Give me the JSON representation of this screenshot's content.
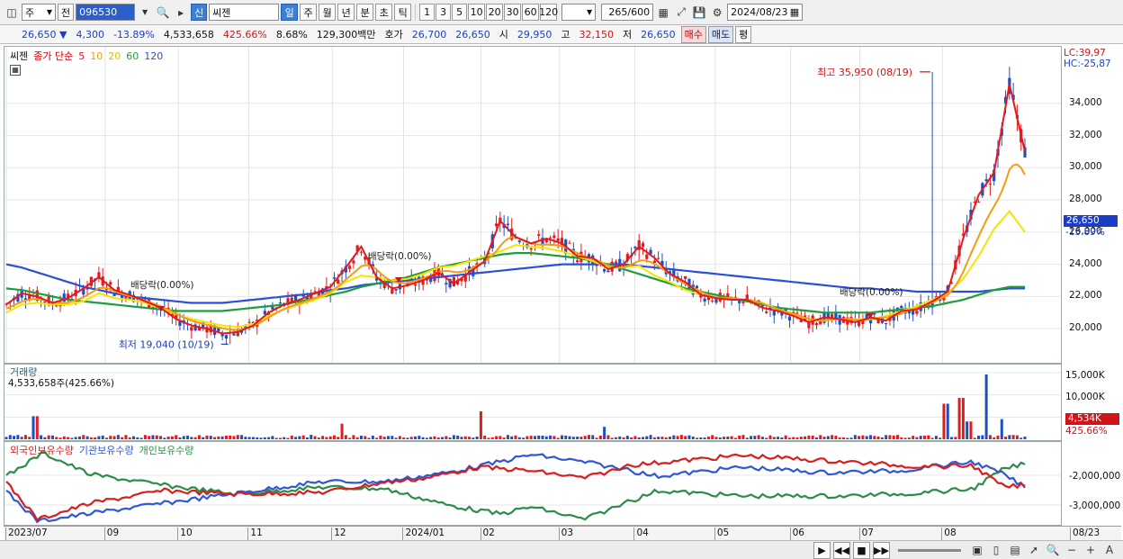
{
  "toolbar": {
    "period_week": "주",
    "prev_label": "전",
    "code": "096530",
    "badge_new": "신",
    "stock_name": "씨젠",
    "tf_day": "일",
    "tf_week": "주",
    "tf_month": "월",
    "tf_year": "년",
    "tf_min": "분",
    "tf_sec": "초",
    "tf_tick": "틱",
    "intervals": [
      "1",
      "3",
      "5",
      "10",
      "20",
      "30",
      "60",
      "120"
    ],
    "count": "265",
    "count_total": "/600",
    "date": "2024/08/23"
  },
  "quote": {
    "price": "26,650",
    "change": "4,300",
    "change_pct": "-13.89%",
    "volume": "4,533,658",
    "vol_ratio": "425.66%",
    "turnover": "8.68%",
    "amount": "129,300백만",
    "bid_label": "호가",
    "bid1": "26,700",
    "bid2": "26,650",
    "open_label": "시",
    "open": "29,950",
    "high_label": "고",
    "high": "32,150",
    "low_label": "저",
    "low": "26,650",
    "buy": "매수",
    "sell": "매도",
    "eval": "평"
  },
  "icons": {
    "down_arrow": "down-triangle-icon"
  },
  "chart_data": [
    {
      "type": "line",
      "name": "price",
      "legend": {
        "title": "씨젠",
        "ma_label": "종가 단순",
        "periods": [
          "5",
          "10",
          "20",
          "60",
          "120"
        ]
      },
      "colors": {
        "ma5": "#e41a1c",
        "ma10": "#f39c12",
        "ma20": "#f5e400",
        "ma60": "#1e9e3a",
        "ma120": "#2a50d8",
        "up": "#e41a1c",
        "down": "#1f4fbf"
      },
      "x": [
        "2023/07",
        "09",
        "10",
        "11",
        "12",
        "2024/01",
        "02",
        "03",
        "04",
        "05",
        "06",
        "07",
        "08",
        "08/23"
      ],
      "ylim": [
        18500,
        36500
      ],
      "yticks": [
        "20,000",
        "22,000",
        "24,000",
        "26,000",
        "28,000",
        "30,000",
        "32,000",
        "34,000"
      ],
      "ma5_key": [
        21500,
        22200,
        22000,
        21600,
        21900,
        22500,
        23200,
        22400,
        22100,
        21700,
        21300,
        20600,
        20200,
        20000,
        19700,
        19800,
        20200,
        21000,
        21500,
        21800,
        22200,
        22600,
        23800,
        25100,
        23200,
        22500,
        22700,
        23000,
        23500,
        22800,
        23500,
        24200,
        26700,
        25700,
        25300,
        25600,
        25300,
        24500,
        24400,
        23700,
        24000,
        25100,
        24400,
        23400,
        22900,
        22100,
        21900,
        21800,
        21800,
        21300,
        21100,
        20800,
        20400,
        20700,
        20600,
        20400,
        20700,
        20500,
        21100,
        21200,
        21700,
        22300,
        25600,
        28300,
        29700,
        35200,
        31000
      ],
      "ma20_key": [
        21000,
        21500,
        21600,
        21500,
        21500,
        21700,
        22200,
        21900,
        21800,
        21600,
        21300,
        20900,
        20600,
        20400,
        20200,
        20100,
        20300,
        20800,
        21200,
        21500,
        21800,
        22200,
        22900,
        23300,
        23200,
        23000,
        23100,
        23400,
        23800,
        23900,
        24200,
        24500,
        24800,
        25200,
        25100,
        25000,
        24800,
        24500,
        24200,
        23800,
        23800,
        23900,
        23300,
        22900,
        22400,
        22100,
        21900,
        21900,
        21800,
        21600,
        21200,
        20900,
        20600,
        20500,
        20600,
        20600,
        20600,
        20800,
        21100,
        21400,
        21800,
        22200,
        23100,
        24500,
        26200,
        27300,
        26000
      ],
      "ma60_key": [
        22500,
        22400,
        22200,
        22000,
        21800,
        21700,
        21600,
        21500,
        21400,
        21300,
        21200,
        21100,
        21100,
        21100,
        21100,
        21200,
        21300,
        21400,
        21500,
        21700,
        21900,
        22100,
        22300,
        22600,
        22800,
        23000,
        23200,
        23500,
        23800,
        24000,
        24200,
        24400,
        24600,
        24700,
        24700,
        24600,
        24500,
        24400,
        24200,
        24000,
        23700,
        23400,
        23100,
        22800,
        22500,
        22300,
        22100,
        21900,
        21700,
        21500,
        21300,
        21200,
        21100,
        21000,
        21000,
        21000,
        21000,
        21100,
        21200,
        21300,
        21400,
        21600,
        21800,
        22100,
        22400,
        22600,
        22600
      ],
      "ma120_key": [
        24000,
        23800,
        23500,
        23200,
        22900,
        22600,
        22400,
        22200,
        22000,
        21900,
        21800,
        21700,
        21600,
        21600,
        21600,
        21700,
        21800,
        21900,
        22000,
        22100,
        22200,
        22400,
        22500,
        22700,
        22800,
        22900,
        23000,
        23100,
        23200,
        23300,
        23400,
        23500,
        23600,
        23700,
        23800,
        23900,
        24000,
        24000,
        24000,
        24000,
        24000,
        23900,
        23800,
        23700,
        23600,
        23500,
        23400,
        23300,
        23200,
        23100,
        23000,
        22900,
        22800,
        22700,
        22600,
        22500,
        22500,
        22400,
        22400,
        22300,
        22300,
        22300,
        22300,
        22300,
        22400,
        22500,
        22500
      ],
      "high_label": "최고 35,950 (08/19)",
      "low_label": "최저 19,040 (10/19)",
      "dividend_label": "배당락(0.00%)",
      "lc_label": "LC:39,97",
      "hc_label": "HC:-25,87",
      "last_price": "26,650",
      "last_pct": "-13.89%"
    },
    {
      "type": "bar",
      "name": "volume",
      "legend": "거래량",
      "summary": "4,533,658주(425.66%)",
      "yticks": [
        "15,000K",
        "10,000K",
        "5,000K"
      ],
      "last": "4,534K",
      "last_pct": "425.66%",
      "spikes": [
        {
          "x": 0.028,
          "v": 5200
        },
        {
          "x": 0.33,
          "v": 3500
        },
        {
          "x": 0.465,
          "v": 6300
        },
        {
          "x": 0.588,
          "v": 2800
        },
        {
          "x": 0.922,
          "v": 8000
        },
        {
          "x": 0.938,
          "v": 9300
        },
        {
          "x": 0.945,
          "v": 4000
        },
        {
          "x": 0.961,
          "v": 14600
        },
        {
          "x": 0.978,
          "v": 4534
        }
      ]
    },
    {
      "type": "line",
      "name": "holdings",
      "series_names": [
        "외국인보유수량",
        "기관보유수량",
        "개인보유수량"
      ],
      "colors": [
        "#d81e1e",
        "#2f57d6",
        "#2c8c4a"
      ],
      "yticks": [
        "-2,000,000",
        "-3,000,000"
      ]
    }
  ]
}
